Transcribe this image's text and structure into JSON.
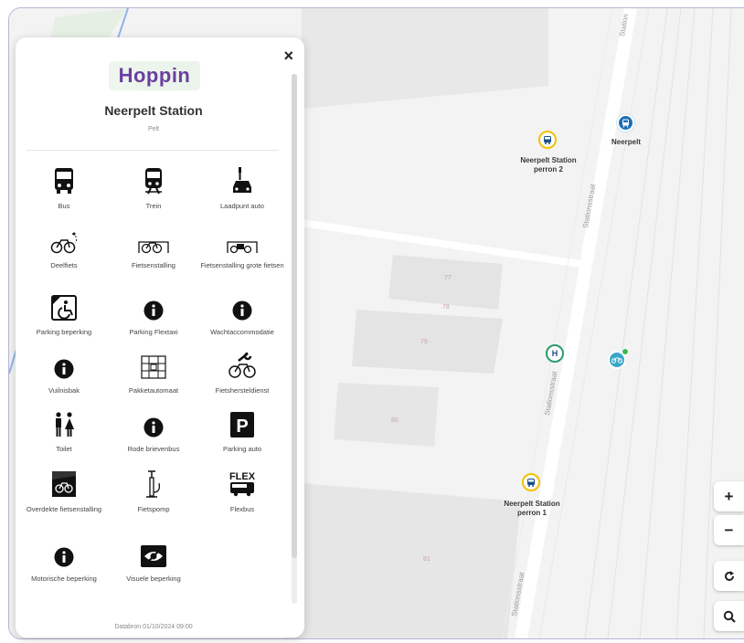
{
  "map": {
    "stops": {
      "bus_perron2": "Neerpelt Station perron 2",
      "bus_perron1": "Neerpelt Station perron 1",
      "train": "Neerpelt"
    },
    "streets": {
      "stationsstraat": "Stationsstraat",
      "station_top": "Station"
    },
    "building_numbers": [
      "77",
      "78",
      "79",
      "80",
      "81"
    ]
  },
  "controls": {
    "zoom_in": "+",
    "zoom_out": "−",
    "reset": "↻",
    "search": "⚲"
  },
  "panel": {
    "logo": "Hoppin",
    "station_name": "Neerpelt Station",
    "city": "Pelt",
    "close": "×",
    "footer": "Databron 01/10/2024 09:00",
    "amenities": [
      {
        "label": "Bus",
        "icon": "bus-icon"
      },
      {
        "label": "Trein",
        "icon": "train-icon"
      },
      {
        "label": "Laadpunt auto",
        "icon": "car-charging-icon"
      },
      {
        "label": "Deelfiets",
        "icon": "shared-bike-icon"
      },
      {
        "label": "Fietsenstalling",
        "icon": "bike-parking-icon"
      },
      {
        "label": "Fietsenstalling grote fietsen",
        "icon": "cargo-bike-parking-icon"
      },
      {
        "label": "Parking beperking",
        "icon": "disabled-parking-icon"
      },
      {
        "label": "Parking Flextaxi",
        "icon": "info-icon"
      },
      {
        "label": "Wachtaccommodatie",
        "icon": "info-icon"
      },
      {
        "label": "Vuilnisbak",
        "icon": "info-icon"
      },
      {
        "label": "Pakketautomaat",
        "icon": "parcel-locker-icon"
      },
      {
        "label": "Fietsherstel­dienst",
        "icon": "bike-repair-icon"
      },
      {
        "label": "Toilet",
        "icon": "toilet-icon"
      },
      {
        "label": "Rode brievenbus",
        "icon": "info-icon"
      },
      {
        "label": "Parking auto",
        "icon": "parking-icon"
      },
      {
        "label": "Overdekte fietsenstalling",
        "icon": "covered-bike-parking-icon"
      },
      {
        "label": "Fietspomp",
        "icon": "bike-pump-icon"
      },
      {
        "label": "Flexbus",
        "icon": "flexbus-icon"
      },
      {
        "label": "Motorische beperking",
        "icon": "info-icon"
      },
      {
        "label": "Visuele beperking",
        "icon": "visual-impairment-icon"
      }
    ]
  }
}
